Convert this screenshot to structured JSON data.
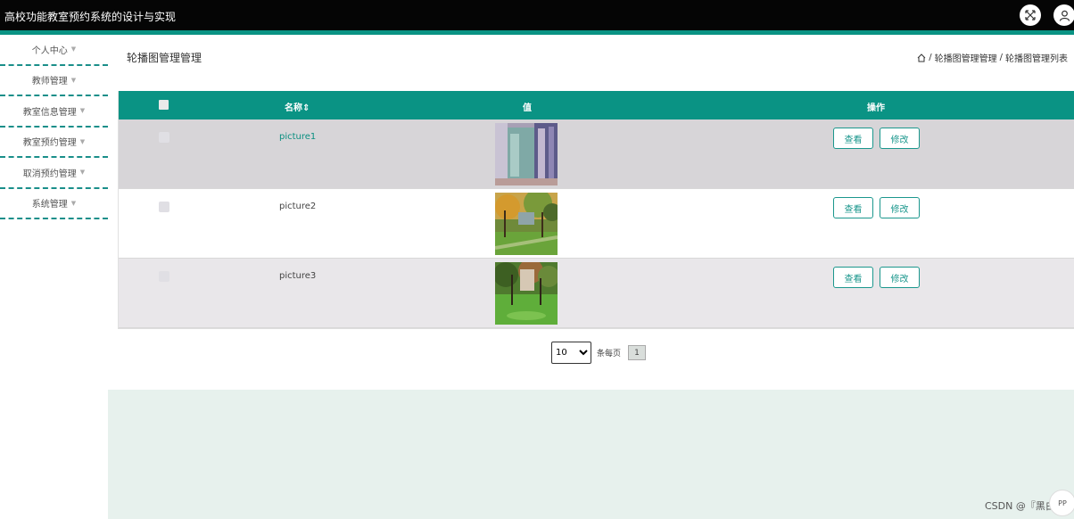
{
  "header": {
    "app_title": "高校功能教室预约系统的设计与实现",
    "fullscreen_icon": "expand-arrows-icon",
    "user_icon": "user-icon"
  },
  "sidebar": {
    "items": [
      {
        "label": "个人中心"
      },
      {
        "label": "教师管理"
      },
      {
        "label": "教室信息管理"
      },
      {
        "label": "教室预约管理"
      },
      {
        "label": "取消预约管理"
      },
      {
        "label": "系统管理"
      }
    ]
  },
  "page": {
    "title": "轮播图管理管理",
    "breadcrumb": {
      "home_icon": "home-icon",
      "separator": "/",
      "items": [
        "轮播图管理管理",
        "轮播图管理列表"
      ]
    }
  },
  "table": {
    "columns": {
      "name": "名称",
      "value": "值",
      "actions": "操作"
    },
    "rows": [
      {
        "name": "picture1",
        "view_label": "查看",
        "edit_label": "修改"
      },
      {
        "name": "picture2",
        "view_label": "查看",
        "edit_label": "修改"
      },
      {
        "name": "picture3",
        "view_label": "查看",
        "edit_label": "修改"
      }
    ]
  },
  "pagination": {
    "page_size": "10",
    "page_size_options": [
      "10"
    ],
    "per_page_label": "条每页",
    "current_page": "1"
  },
  "watermark": "CSDN @『黑白PP",
  "colors": {
    "primary": "#0a9384",
    "topbar": "#050505",
    "footer_bg": "#e7f1ed"
  }
}
